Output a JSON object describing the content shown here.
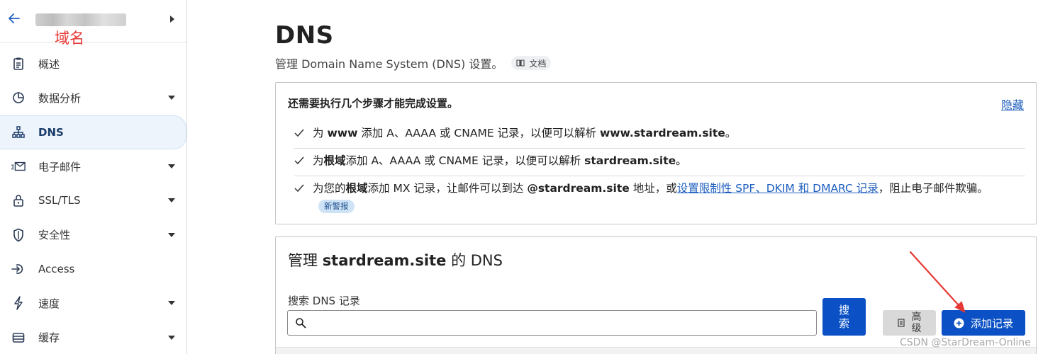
{
  "sidebar": {
    "domain_annotation": "域名",
    "items": [
      {
        "label": "概述",
        "icon": "clipboard-icon",
        "has_caret": false,
        "active": false
      },
      {
        "label": "数据分析",
        "icon": "pie-chart-icon",
        "has_caret": true,
        "active": false
      },
      {
        "label": "DNS",
        "icon": "sitemap-icon",
        "has_caret": false,
        "active": true
      },
      {
        "label": "电子邮件",
        "icon": "email-icon",
        "has_caret": true,
        "active": false
      },
      {
        "label": "SSL/TLS",
        "icon": "lock-icon",
        "has_caret": true,
        "active": false
      },
      {
        "label": "安全性",
        "icon": "shield-icon",
        "has_caret": true,
        "active": false
      },
      {
        "label": "Access",
        "icon": "access-icon",
        "has_caret": false,
        "active": false
      },
      {
        "label": "速度",
        "icon": "lightning-icon",
        "has_caret": true,
        "active": false
      },
      {
        "label": "缓存",
        "icon": "storage-icon",
        "has_caret": true,
        "active": false
      }
    ]
  },
  "header": {
    "title": "DNS",
    "subtitle": "管理 Domain Name System (DNS) 设置。",
    "doc_badge": "文档"
  },
  "steps": {
    "title": "还需要执行几个步骤才能完成设置。",
    "hide_link": "隐藏",
    "step1": {
      "a": "为 ",
      "b": "www",
      "c": " 添加 A、AAAA 或 CNAME 记录，以便可以解析 ",
      "d": "www.stardream.site",
      "e": "。"
    },
    "step2": {
      "a": "为",
      "b": "根域",
      "c": "添加 A、AAAA 或 CNAME 记录，以便可以解析 ",
      "d": "stardream.site",
      "e": "。"
    },
    "step3": {
      "a": "为您的",
      "b": "根域",
      "c": "添加 MX 记录，让邮件可以到达 ",
      "d": "@stardream.site",
      "e": " 地址，或",
      "link": "设置限制性 SPF、DKIM 和 DMARC 记录",
      "f": "，阻止电子邮件欺骗。",
      "badge": "新警报"
    }
  },
  "dns_card": {
    "title_prefix": "管理 ",
    "domain": "stardream.site",
    "title_suffix": " 的 DNS",
    "search_label": "搜索 DNS 记录",
    "search_value": "",
    "search_button": "搜\n索",
    "advanced_button": "高\n级",
    "add_record_button": "添加记录"
  },
  "watermark": "CSDN @StarDream-Online",
  "colors": {
    "primary": "#0b51c5",
    "link": "#1f5fbf",
    "annotation": "#e53935"
  }
}
